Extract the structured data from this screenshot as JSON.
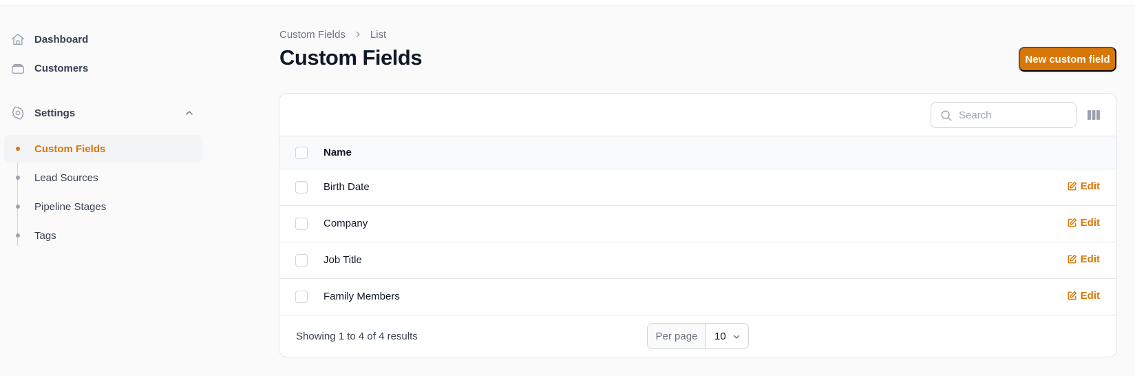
{
  "sidebar": {
    "items": [
      {
        "label": "Dashboard",
        "icon": "home-icon"
      },
      {
        "label": "Customers",
        "icon": "inbox-stack-icon"
      }
    ],
    "group": {
      "label": "Settings",
      "icon": "gear-icon",
      "expanded": true,
      "items": [
        {
          "label": "Custom Fields",
          "active": true
        },
        {
          "label": "Lead Sources",
          "active": false
        },
        {
          "label": "Pipeline Stages",
          "active": false
        },
        {
          "label": "Tags",
          "active": false
        }
      ]
    }
  },
  "breadcrumb": [
    "Custom Fields",
    "List"
  ],
  "page": {
    "title": "Custom Fields",
    "new_button": "New custom field"
  },
  "table": {
    "search_placeholder": "Search",
    "columns": [
      "Name"
    ],
    "rows": [
      {
        "name": "Birth Date",
        "action": "Edit"
      },
      {
        "name": "Company",
        "action": "Edit"
      },
      {
        "name": "Job Title",
        "action": "Edit"
      },
      {
        "name": "Family Members",
        "action": "Edit"
      }
    ],
    "summary": "Showing 1 to 4 of 4 results",
    "per_page_label": "Per page",
    "per_page_value": "10"
  },
  "colors": {
    "accent": "#d97706",
    "background": "#fafafa",
    "border": "#e5e7eb"
  }
}
